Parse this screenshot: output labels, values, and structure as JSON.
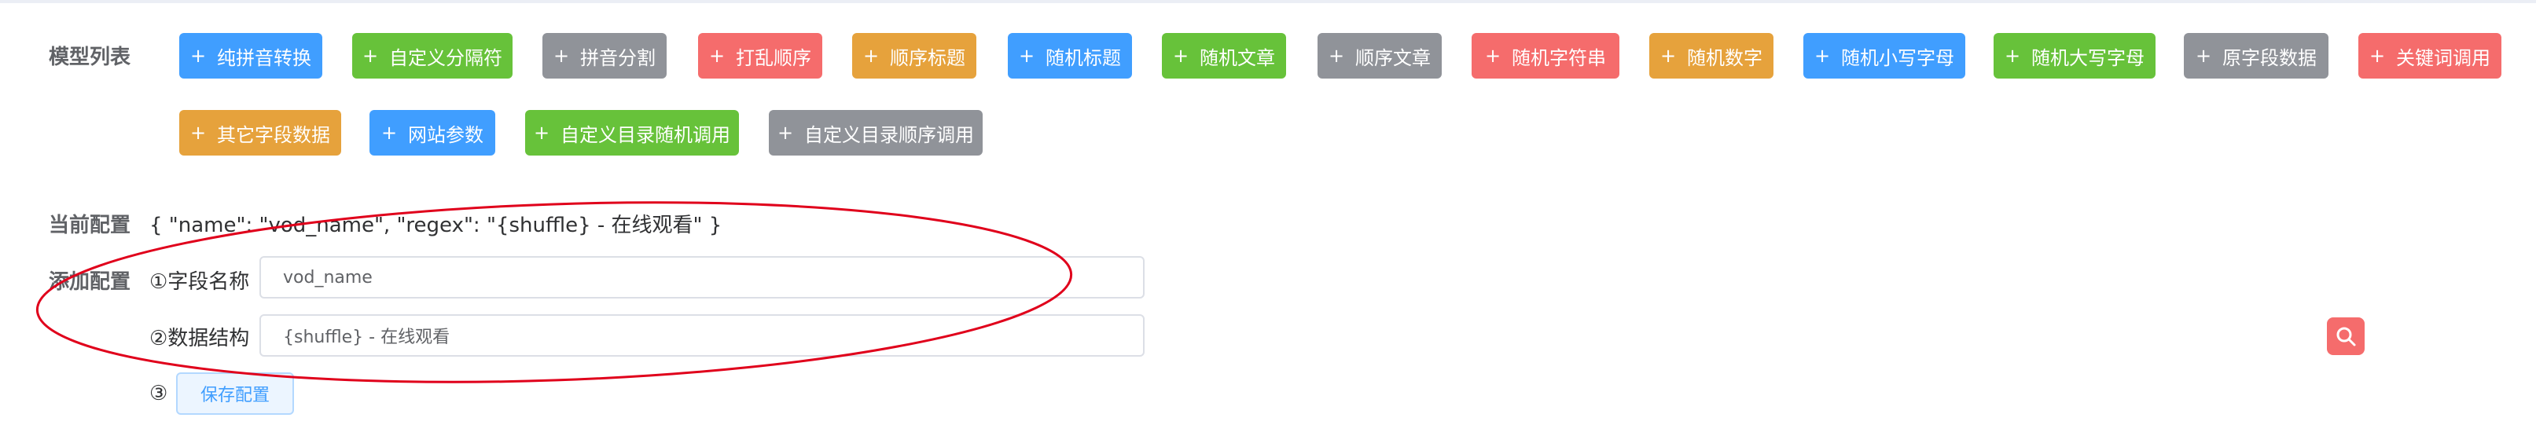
{
  "model_list": {
    "label": "模型列表",
    "buttons": [
      {
        "label": "纯拼音转换",
        "color": "#409eff"
      },
      {
        "label": "自定义分隔符",
        "color": "#67c23a"
      },
      {
        "label": "拼音分割",
        "color": "#909399"
      },
      {
        "label": "打乱顺序",
        "color": "#f56c6c"
      },
      {
        "label": "顺序标题",
        "color": "#e6a23c"
      },
      {
        "label": "随机标题",
        "color": "#409eff"
      },
      {
        "label": "随机文章",
        "color": "#67c23a"
      },
      {
        "label": "顺序文章",
        "color": "#909399"
      },
      {
        "label": "随机字符串",
        "color": "#f56c6c"
      },
      {
        "label": "随机数字",
        "color": "#e6a23c"
      },
      {
        "label": "随机小写字母",
        "color": "#409eff"
      },
      {
        "label": "随机大写字母",
        "color": "#67c23a"
      },
      {
        "label": "原字段数据",
        "color": "#909399"
      },
      {
        "label": "关键词调用",
        "color": "#f56c6c"
      },
      {
        "label": "其它字段数据",
        "color": "#e6a23c"
      },
      {
        "label": "网站参数",
        "color": "#409eff"
      },
      {
        "label": "自定义目录随机调用",
        "color": "#67c23a"
      },
      {
        "label": "自定义目录顺序调用",
        "color": "#909399"
      }
    ],
    "plus_icon": "+"
  },
  "current_config": {
    "label": "当前配置",
    "value": "{ \"name\": \"vod_name\", \"regex\": \"{shuffle} - 在线观看\" }"
  },
  "add_config": {
    "label": "添加配置",
    "field_name_label": "①字段名称",
    "field_name_value": "vod_name",
    "data_structure_label": "②数据结构",
    "data_structure_value": "{shuffle} - 在线观看",
    "step3_label": "③",
    "save_label": "保存配置"
  },
  "icons": {
    "search": "search-icon"
  },
  "annotation": {
    "ellipse_color": "#e0001b"
  }
}
